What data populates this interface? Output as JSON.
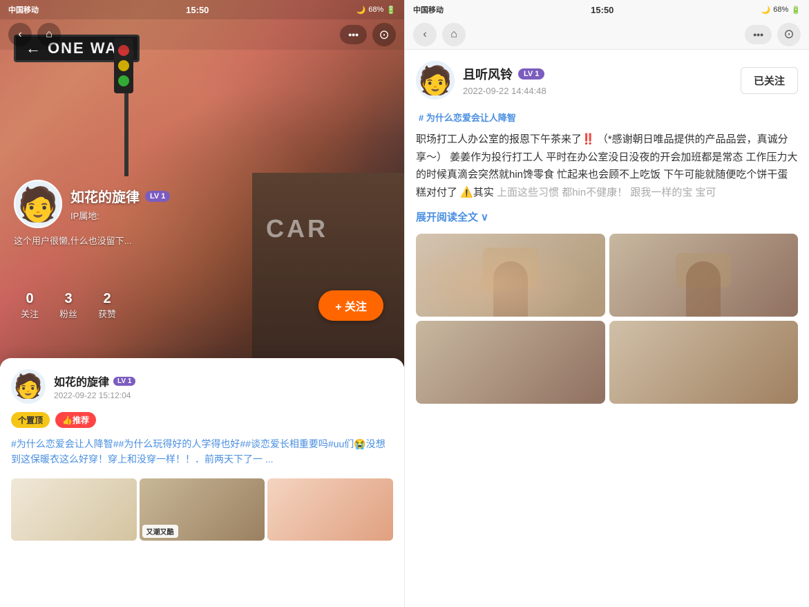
{
  "left": {
    "status_bar": {
      "carrier": "中国移动",
      "time": "15:50",
      "battery": "68%"
    },
    "nav": {
      "back_label": "‹",
      "home_label": "⌂",
      "dots_label": "•••",
      "record_label": "⊙"
    },
    "profile": {
      "name": "如花的旋律",
      "lv_badge": "LV 1",
      "ip_label": "IP属地:",
      "bio": "这个用户很懒,什么也没留下...",
      "avatar_emoji": "🧑"
    },
    "stats": [
      {
        "num": "0",
        "label": "关注"
      },
      {
        "num": "3",
        "label": "粉丝"
      },
      {
        "num": "2",
        "label": "获赞"
      }
    ],
    "follow_btn": "+ 关注",
    "street_sign": "ONE WAY",
    "post": {
      "name": "如花的旋律",
      "lv_badge": "LV 1",
      "time": "2022-09-22 15:12:04",
      "pin_badge": "个置顶",
      "rec_badge": "👍推荐",
      "content": "#为什么恋爱会让人降智##为什么玩得好的人学得也好##谈恋爱长相重要吗#uu们😭没想到这保暖衣这么好穿！穿上和没穿一样！！．前两天下了一 ..."
    }
  },
  "right": {
    "status_bar": {
      "carrier": "中国移动",
      "time": "15:50",
      "battery": "68%"
    },
    "nav": {
      "back_label": "‹",
      "home_label": "⌂",
      "dots_label": "•••",
      "record_label": "⊙"
    },
    "post": {
      "name": "且听风铃",
      "lv_badge": "LV 1",
      "time": "2022-09-22 14:44:48",
      "follow_btn": "已关注",
      "topic": "# 为什么恋爱会让人降智",
      "title": "",
      "body": "职场打工人办公室的报恩下午茶来了‼️  （*感谢朝日唯品提供的产品品尝，真诚分享～）   姜姜作为投行打工人  平时在办公室没日没夜的开会加班都是常态  工作压力大的时候真滴会突然就hin馋零食  忙起来也会顾不上吃饭  下午可能就随便吃个饼干蛋糕对付了  ⚠️其实",
      "faded_text": "上面这些习惯 都hin不健康！  跟我一样的宝 宝可",
      "expand_label": "展开阅读全文",
      "expand_icon": "∨"
    }
  }
}
